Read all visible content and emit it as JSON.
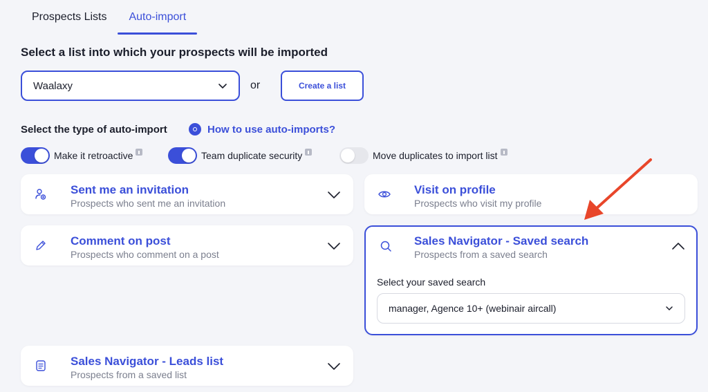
{
  "tabs": [
    {
      "label": "Prospects Lists",
      "active": false
    },
    {
      "label": "Auto-import",
      "active": true
    }
  ],
  "list_section": {
    "title": "Select a list into which your prospects will be imported",
    "selected_list": "Waalaxy",
    "or_text": "or",
    "create_button": "Create a list"
  },
  "type_section": {
    "title": "Select the type of auto-import",
    "help_link": "How to use auto-imports?"
  },
  "toggles": [
    {
      "label": "Make it retroactive",
      "on": true
    },
    {
      "label": "Team duplicate security",
      "on": true
    },
    {
      "label": "Move duplicates to import list",
      "on": false
    }
  ],
  "cards": {
    "invitation": {
      "title": "Sent me an invitation",
      "subtitle": "Prospects who sent me an invitation",
      "icon": "user-plus-icon"
    },
    "visit": {
      "title": "Visit on profile",
      "subtitle": "Prospects who visit my profile",
      "icon": "eye-icon"
    },
    "comment": {
      "title": "Comment on post",
      "subtitle": "Prospects who comment on a post",
      "icon": "pencil-icon"
    },
    "saved_search": {
      "title": "Sales Navigator - Saved search",
      "subtitle": "Prospects from a saved search",
      "icon": "search-icon",
      "select_label": "Select your saved search",
      "selected_value": "manager, Agence 10+ (webinair aircall)"
    },
    "leads_list": {
      "title": "Sales Navigator - Leads list",
      "subtitle": "Prospects from a saved list",
      "icon": "document-icon"
    }
  },
  "colors": {
    "accent": "#3b4fd9",
    "background": "#f4f5f9",
    "arrow": "#e8462a",
    "muted_text": "#7b7f8e"
  }
}
